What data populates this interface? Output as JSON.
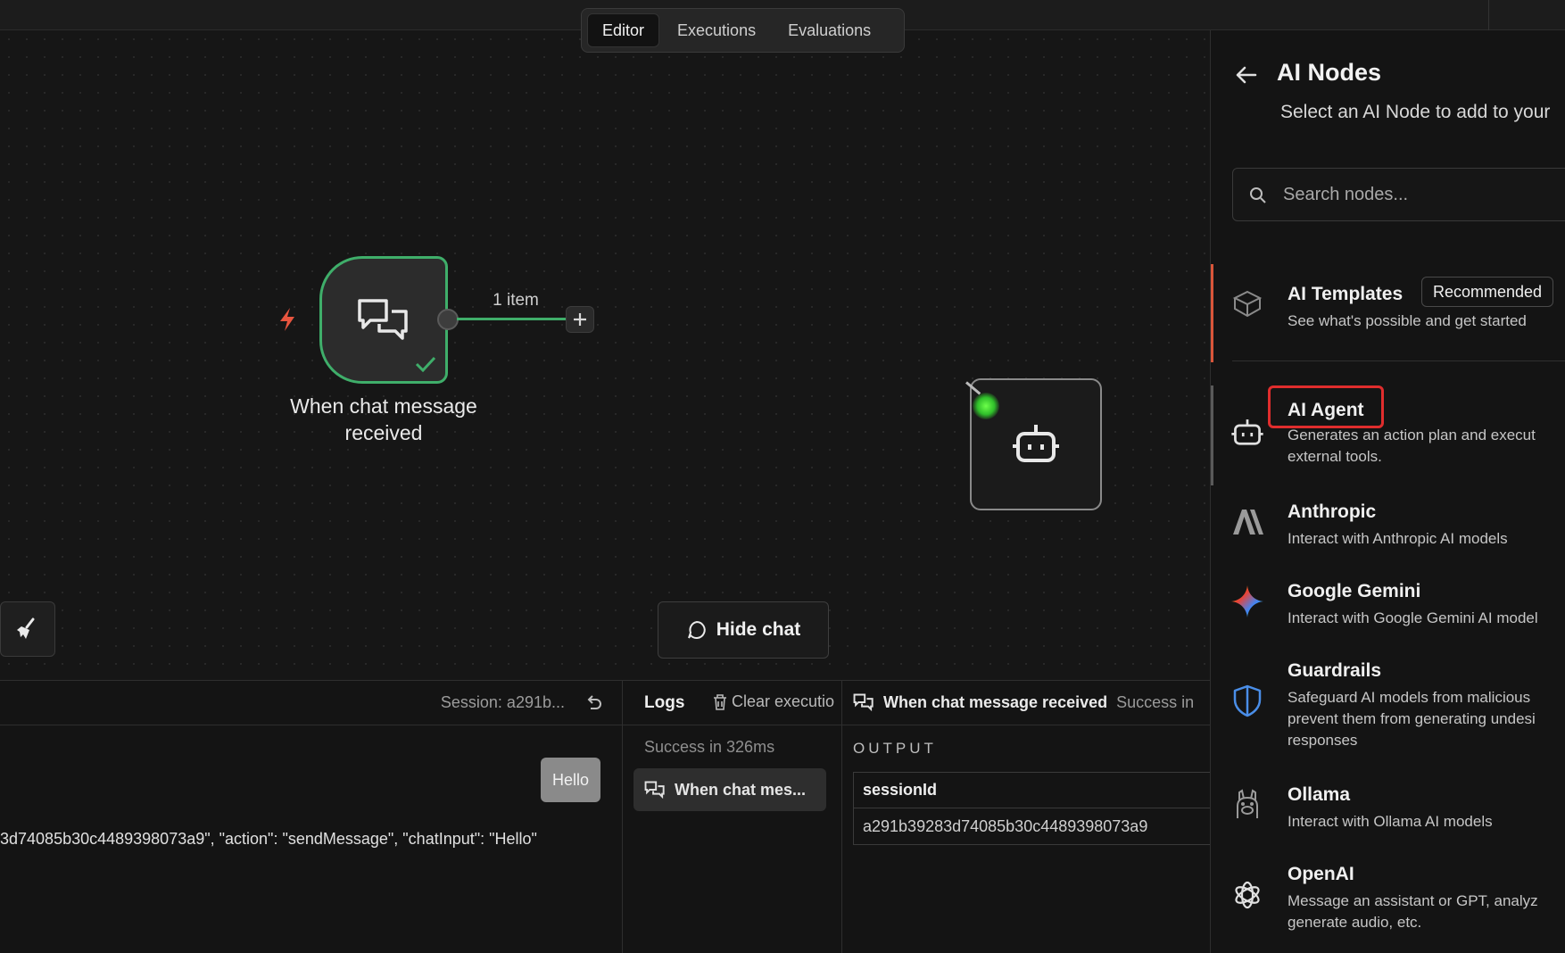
{
  "tabs": [
    "Editor",
    "Executions",
    "Evaluations"
  ],
  "canvas": {
    "trigger_node_label": "When chat message received",
    "connection_label": "1 item",
    "hide_chat_label": "Hide chat"
  },
  "chat_panel": {
    "session_label": "Session: a291b...",
    "message": "Hello",
    "json_text": "3d74085b30c4489398073a9\", \"action\": \"sendMessage\", \"chatInput\": \"Hello\""
  },
  "logs_panel": {
    "title": "Logs",
    "clear_label": "Clear executio",
    "status": "Success in 326ms",
    "entry_label": "When chat mes..."
  },
  "output_panel": {
    "node_name": "When chat message received",
    "status": "Success in",
    "section_label": "OUTPUT",
    "column_header": "sessionId",
    "value": "a291b39283d74085b30c4489398073a9"
  },
  "side_panel": {
    "title": "AI Nodes",
    "subtitle": "Select an AI Node to add to your",
    "search_placeholder": "Search nodes...",
    "items": [
      {
        "name": "AI Templates",
        "badge": "Recommended",
        "desc": "See what's possible and get started"
      },
      {
        "name": "AI Agent",
        "desc": "Generates an action plan and execut\nexternal tools."
      },
      {
        "name": "Anthropic",
        "desc": "Interact with Anthropic AI models"
      },
      {
        "name": "Google Gemini",
        "desc": "Interact with Google Gemini AI model"
      },
      {
        "name": "Guardrails",
        "desc": "Safeguard AI models from malicious\nprevent them from generating undesi\nresponses"
      },
      {
        "name": "Ollama",
        "desc": "Interact with Ollama AI models"
      },
      {
        "name": "OpenAI",
        "desc": "Message an assistant or GPT, analyz\ngenerate audio, etc."
      }
    ]
  },
  "colors": {
    "accent_green": "#3fae6a",
    "highlight_red": "#e02d2d",
    "trigger_orange": "#e8553f"
  }
}
